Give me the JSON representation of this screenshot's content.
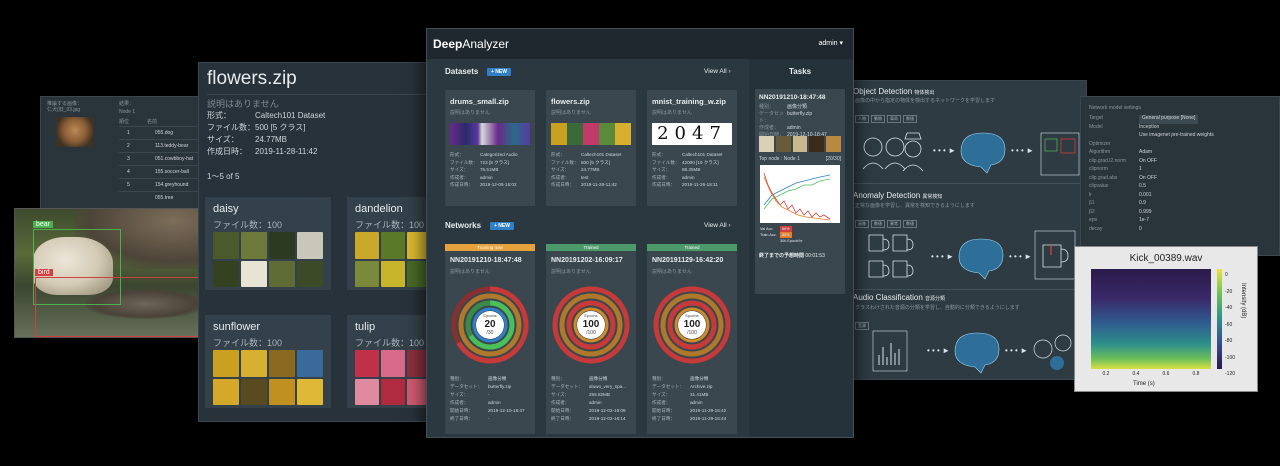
{
  "back_panel": {
    "label1": "推論する画像：",
    "label2": "結果：",
    "file": "仁犬(旧_03.jpg",
    "node": "Node 1",
    "col_rank": "順位",
    "col_name": "名前",
    "rows": [
      {
        "rank": "1",
        "name": "055.dog"
      },
      {
        "rank": "2",
        "name": "113.teddy-bear"
      },
      {
        "rank": "3",
        "name": "051.cowbboy-hat"
      },
      {
        "rank": "4",
        "name": "155.soccer-ball"
      },
      {
        "rank": "5",
        "name": "154.greyhound"
      },
      {
        "rank": "",
        "name": "055.tree"
      }
    ]
  },
  "detection_image": {
    "labels": [
      "bear",
      "bird"
    ]
  },
  "flowers": {
    "title": "flowers.zip",
    "desc": "説明はありません",
    "fields": [
      {
        "k": "形式：",
        "v": "Caltech101 Dataset"
      },
      {
        "k": "ファイル数：",
        "v": "500 [5 クラス]"
      },
      {
        "k": "サイズ：",
        "v": "24.77MB"
      },
      {
        "k": "作成日時：",
        "v": "2019-11-28-11:42"
      }
    ],
    "paging": "1〜5 of 5",
    "classes": [
      {
        "name": "daisy",
        "count": "ファイル数：100"
      },
      {
        "name": "dandelion",
        "count": "ファイル数：100"
      },
      {
        "name": "sunflower",
        "count": "ファイル数：100"
      },
      {
        "name": "tulip",
        "count": "ファイル数：100"
      }
    ]
  },
  "main": {
    "logo_bold": "Deep",
    "logo_light": "Analyzer",
    "user": "admin",
    "datasets_title": "Datasets",
    "new_label": "+ NEW",
    "view_all": "View All",
    "datasets": [
      {
        "name": "drums_small.zip",
        "desc": "説明はありません",
        "kv": [
          [
            "形式：",
            "Categorized Audio"
          ],
          [
            "ファイル数：",
            "723 [8 クラス]"
          ],
          [
            "サイズ：",
            "75.51MB"
          ],
          [
            "作成者：",
            "admin"
          ],
          [
            "作成日時：",
            "2019-12-05-16:02"
          ]
        ]
      },
      {
        "name": "flowers.zip",
        "desc": "説明はありません",
        "kv": [
          [
            "形式：",
            "Caltech101 Dataset"
          ],
          [
            "ファイル数：",
            "500 [5 クラス]"
          ],
          [
            "サイズ：",
            "24.77MB"
          ],
          [
            "作成者：",
            "test"
          ],
          [
            "作成日時：",
            "2019-11-28-11:42"
          ]
        ]
      },
      {
        "name": "mnist_training_w.zip",
        "desc": "説明はありません",
        "digits": "2047",
        "kv": [
          [
            "形式：",
            "Caltech101 Dataset"
          ],
          [
            "ファイル数：",
            "42000 [10 クラス]"
          ],
          [
            "サイズ：",
            "88.35MB"
          ],
          [
            "作成者：",
            "admin"
          ],
          [
            "作成日時：",
            "2019-11-26-18:11"
          ]
        ]
      }
    ],
    "networks_title": "Networks",
    "networks": [
      {
        "status": "Training now",
        "status_color": "#e6a23c",
        "name": "NN20191210-18:47:48",
        "desc": "説明はありません",
        "epoch_label": "Epochs",
        "epoch": "20",
        "total": "/30",
        "progress": 0.667,
        "kv": [
          [
            "種別：",
            "画像分類"
          ],
          [
            "データセット：",
            "butterfly.zip"
          ],
          [
            "サイズ：",
            "-"
          ],
          [
            "作成者：",
            "admin"
          ],
          [
            "開始日時：",
            "2019-12-10-18:47"
          ],
          [
            "終了日時：",
            "-"
          ]
        ]
      },
      {
        "status": "Trained",
        "status_color": "#4c9a6a",
        "name": "NN20191202-16:09:17",
        "desc": "説明はありません",
        "epoch_label": "Epochs",
        "epoch": "100",
        "total": "/100",
        "progress": 1.0,
        "kv": [
          [
            "種別：",
            "画像分類"
          ],
          [
            "データセット：",
            "aluwo_very_spa..."
          ],
          [
            "サイズ：",
            "255.82MB"
          ],
          [
            "作成者：",
            "admin"
          ],
          [
            "開始日時：",
            "2019-12-02-16:09"
          ],
          [
            "終了日時：",
            "2019-12-02-16:14"
          ]
        ]
      },
      {
        "status": "Trained",
        "status_color": "#4c9a6a",
        "name": "NN20191129-16:42:20",
        "desc": "説明はありません",
        "epoch_label": "Epochs",
        "epoch": "100",
        "total": "/100",
        "progress": 1.0,
        "kv": [
          [
            "種別：",
            "画像分類"
          ],
          [
            "データセット：",
            "Archive.zip"
          ],
          [
            "サイズ：",
            "31.41MB"
          ],
          [
            "作成者：",
            "admin"
          ],
          [
            "開始日時：",
            "2019-11-29-16:42"
          ],
          [
            "終了日時：",
            "2019-11-29-16:44"
          ]
        ]
      }
    ],
    "tasks_title": "Tasks",
    "task": {
      "name": "NN20191210-18:47:48",
      "kv": [
        [
          "種別：",
          "画像分類"
        ],
        [
          "データセット：",
          "butterfly.zip"
        ],
        [
          "作成者：",
          "admin"
        ],
        [
          "開始日時：",
          "2019-12-10-18:47"
        ]
      ],
      "top_node": "Top node : Node 1",
      "count": "[20/30]",
      "legend": [
        {
          "k": "Val Acc.",
          "v": "66%"
        },
        {
          "k": "Train Acc.",
          "v": "80%"
        },
        {
          "k": "",
          "v": "306 Epoch/hr"
        }
      ],
      "eta_label": "終了までの予想時間",
      "eta": "00:01:53"
    }
  },
  "right": {
    "sections": [
      {
        "title": "Object Detection",
        "sub": "物体検出",
        "desc": "画像の中から指定の物体を検出するネットワークを学習します",
        "tags": [
          "人物",
          "動物",
          "車両",
          "数値"
        ]
      },
      {
        "title": "Anomaly Detection",
        "sub": "異常検知",
        "desc": "正常な画像を学習し、異常を検知できるようにします",
        "tags": [
          "画像",
          "数値",
          "異常",
          "数値"
        ]
      },
      {
        "title": "Audio Classification",
        "sub": "音源分類",
        "desc": "クラスわけされた音源の分類を学習し、自動的に分類できるようにします",
        "tags": [
          "音源"
        ]
      }
    ]
  },
  "settings": {
    "title": "Network model settings",
    "rows": [
      {
        "k": "Target",
        "v": "General purpose [None]"
      },
      {
        "k": "Model",
        "v": "Inception"
      },
      {
        "k": "",
        "v": "Use imagenet pre-trained weights"
      },
      {
        "k": "Optimizer",
        "v": ""
      },
      {
        "k": "Algorithm",
        "v": "Adam"
      },
      {
        "k": "clip.grad.l2.norm",
        "v": "On   OFF"
      },
      {
        "k": "clipnorm",
        "v": "1"
      },
      {
        "k": "clip.grad.abs",
        "v": "On   OFF"
      },
      {
        "k": "clipvalue",
        "v": "0.5"
      },
      {
        "k": "lr",
        "v": "0.001"
      },
      {
        "k": "β1",
        "v": "0.9"
      },
      {
        "k": "β2",
        "v": "0.999"
      },
      {
        "k": "eps",
        "v": "1e-7"
      },
      {
        "k": "decay",
        "v": "0"
      }
    ]
  },
  "spectro": {
    "title": "Kick_00389.wav",
    "xlabel": "Time (s)",
    "ylabel": "Intensity (dB)",
    "xticks": [
      "0.2",
      "0.4",
      "0.6",
      "0.8"
    ],
    "cticks": [
      "0",
      "-20",
      "-40",
      "-60",
      "-80",
      "-100",
      "-120"
    ]
  }
}
